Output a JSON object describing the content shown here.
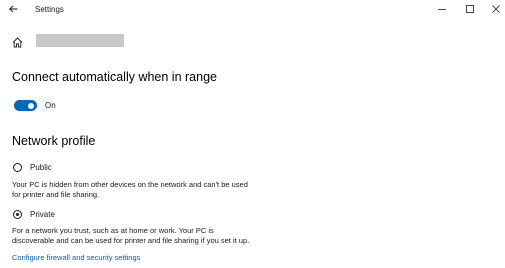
{
  "window": {
    "title": "Settings",
    "back_icon": "arrow-left-icon",
    "minimize_icon": "minimize-icon",
    "maximize_icon": "maximize-icon",
    "close_icon": "close-icon"
  },
  "header": {
    "home_icon": "home-icon"
  },
  "auto_connect": {
    "heading": "Connect automatically when in range",
    "toggle_state": "On",
    "toggle_on": true,
    "accent_color": "#0067c0"
  },
  "network_profile": {
    "heading": "Network profile",
    "options": [
      {
        "label": "Public",
        "selected": false,
        "description_line1": "Your PC is hidden from other devices on the network and can't be used",
        "description_line2": "for printer and file sharing."
      },
      {
        "label": "Private",
        "selected": true,
        "description_line1": "For a network you trust, such as at home or work. Your PC is",
        "description_line2": "discoverable and can be used for printer and file sharing if you set it up."
      }
    ],
    "firewall_link": "Configure firewall and security settings",
    "link_color": "#0063b1"
  }
}
